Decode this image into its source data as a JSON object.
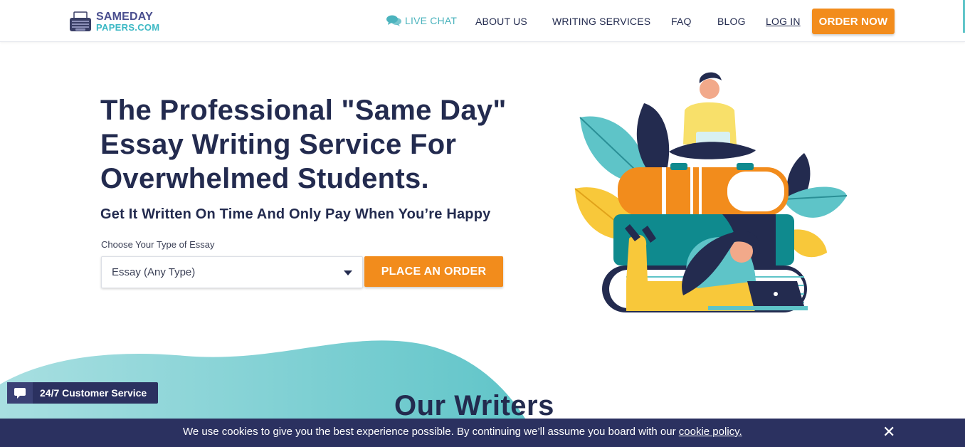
{
  "header": {
    "logo": {
      "line1": "SAMEDAY",
      "line2": "PAPERS.COM",
      "icon": "typewriter-icon"
    },
    "nav": {
      "live_chat": "LIVE CHAT",
      "about": "ABOUT US",
      "writing_services": "WRITING SERVICES",
      "faq": "FAQ",
      "blog": "BLOG",
      "login": "LOG IN"
    },
    "order_now": "ORDER NOW"
  },
  "hero": {
    "title_line1": "The Professional \"Same Day\"",
    "title_line2": "Essay Writing Service For",
    "title_line3": "Overwhelmed Students.",
    "subtitle": "Get It Written On Time And Only Pay When You’re Happy",
    "select_label": "Choose Your Type of Essay",
    "select_value": "Essay (Any Type)",
    "place_order": "PLACE AN ORDER"
  },
  "section": {
    "title": "Our Writers"
  },
  "support_widget": {
    "label": "24/7 Customer Service",
    "icon": "chat-bubble-icon"
  },
  "cookie_bar": {
    "text": "We use cookies to give you the best experience possible. By continuing we’ll assume you board with our ",
    "link": "cookie policy.",
    "close": "✕"
  },
  "colors": {
    "navy": "#232b4f",
    "orange": "#f28c1c",
    "teal": "#3bb8c4",
    "bar": "#2b3160"
  }
}
